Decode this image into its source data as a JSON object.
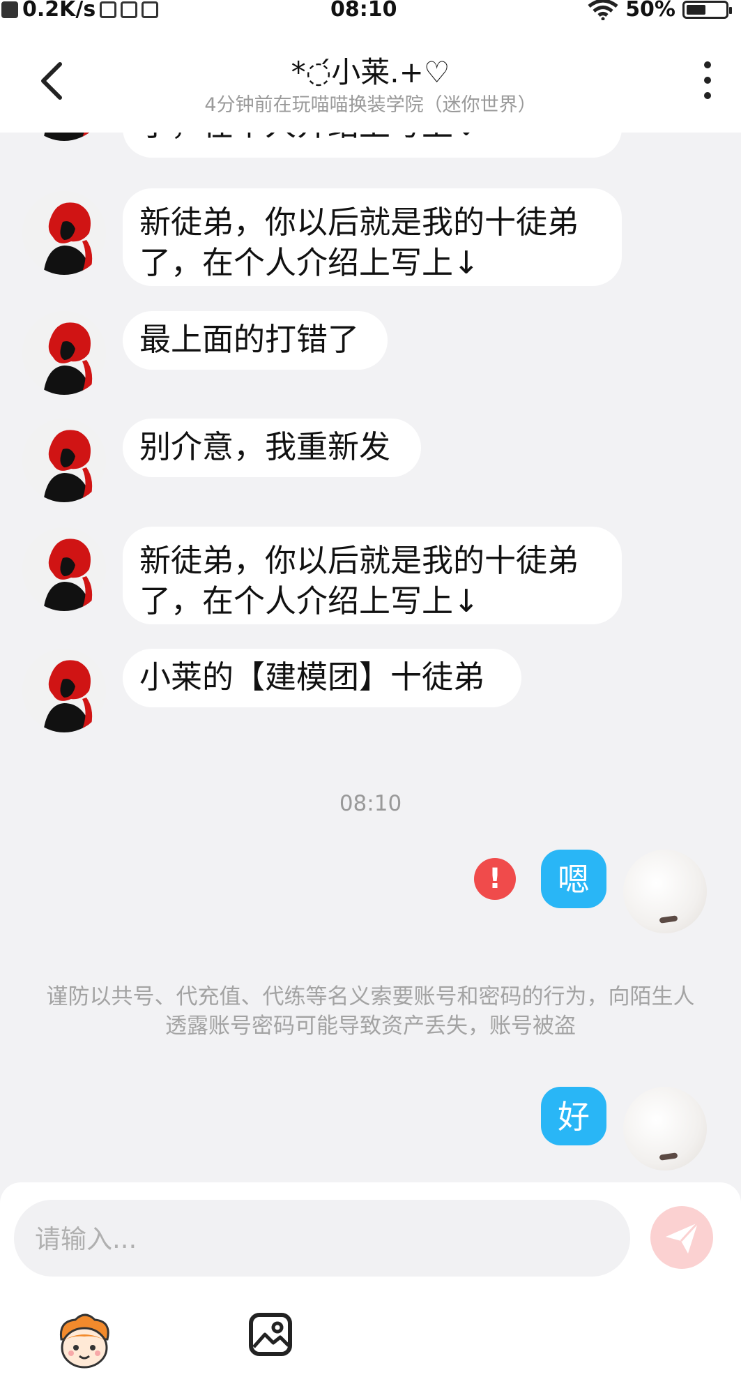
{
  "status_bar": {
    "speed": "0.2K/s",
    "time": "08:10",
    "battery": "50%",
    "battery_level": 0.5
  },
  "header": {
    "title": "*◌́小莱.+♡",
    "subtitle": "4分钟前在玩喵喵换装学院（迷你世界）",
    "back_icon": "chevron-left-icon",
    "more_icon": "more-vertical-icon"
  },
  "messages": [
    {
      "sender": "other",
      "text": "了，在个人介绍上写上↓"
    },
    {
      "sender": "other",
      "text": "新徒弟，你以后就是我的十徒弟\n了，在个人介绍上写上↓"
    },
    {
      "sender": "other",
      "text": "最上面的打错了"
    },
    {
      "sender": "other",
      "text": "别介意，我重新发"
    },
    {
      "sender": "other",
      "text": "新徒弟，你以后就是我的十徒弟\n了，在个人介绍上写上↓"
    },
    {
      "sender": "other",
      "text": "小莱的【建模团】十徒弟"
    }
  ],
  "timestamp": "08:10",
  "my_messages": [
    {
      "text": "嗯",
      "status": "failed"
    },
    {
      "text": "好"
    }
  ],
  "notice": "谨防以共号、代充值、代练等名义索要账号和密码的行为，向陌生人透露账号密码可能导致资产丢失，账号被盗",
  "input": {
    "placeholder": "请输入..."
  },
  "toolbar": {
    "mascot_icon": "mascot-icon",
    "image_icon": "image-icon",
    "send_icon": "send-icon"
  },
  "colors": {
    "my_bubble": "#29b6f6",
    "error": "#f04b4b",
    "send_button": "#fbd1d1",
    "background": "#f2f2f4"
  }
}
